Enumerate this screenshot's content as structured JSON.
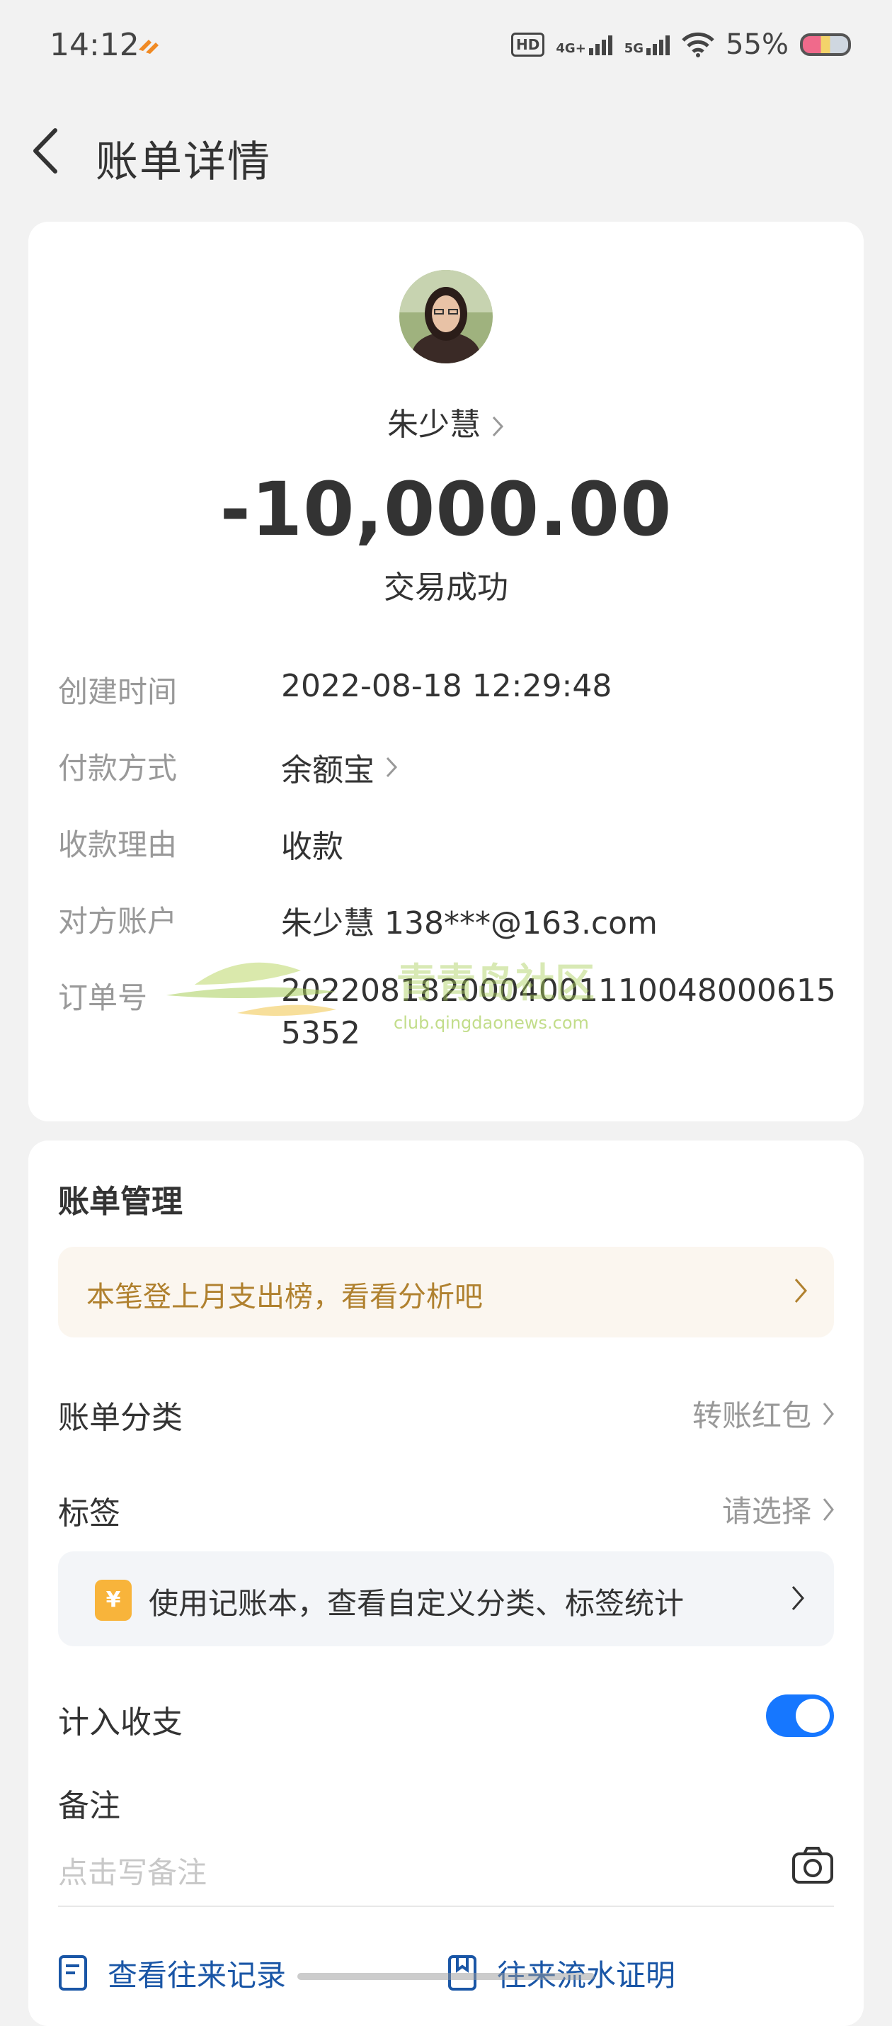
{
  "status_bar": {
    "time": "14:12",
    "battery": "55%",
    "network_1": "4G+",
    "network_2": "5G",
    "hd": "HD"
  },
  "nav": {
    "title": "账单详情"
  },
  "summary": {
    "payee": "朱少慧",
    "amount": "-10,000.00",
    "status": "交易成功"
  },
  "details": [
    {
      "label": "创建时间",
      "value": "2022-08-18 12:29:48"
    },
    {
      "label": "付款方式",
      "value": "余额宝"
    },
    {
      "label": "收款理由",
      "value": "收款"
    },
    {
      "label": "对方账户",
      "value": "朱少慧 138***@163.com"
    },
    {
      "label": "订单号",
      "value": "20220818200040011100480006155352"
    }
  ],
  "watermark": {
    "text": "青青岛社区",
    "url": "club.qingdaonews.com"
  },
  "management": {
    "title": "账单管理",
    "promo": "本笔登上月支出榜，看看分析吧",
    "category_label": "账单分类",
    "category_value": "转账红包",
    "tag_label": "标签",
    "tag_value": "请选择",
    "tip_icon": "¥",
    "tip": "使用记账本，查看自定义分类、标签统计",
    "include_label": "计入收支",
    "include_on": true,
    "remark_label": "备注",
    "remark_placeholder": "点击写备注",
    "link_history": "查看往来记录",
    "link_proof": "往来流水证明"
  },
  "colors": {
    "accent": "#1677ff",
    "promo_text": "#b0812f",
    "link": "#1a56a6"
  }
}
